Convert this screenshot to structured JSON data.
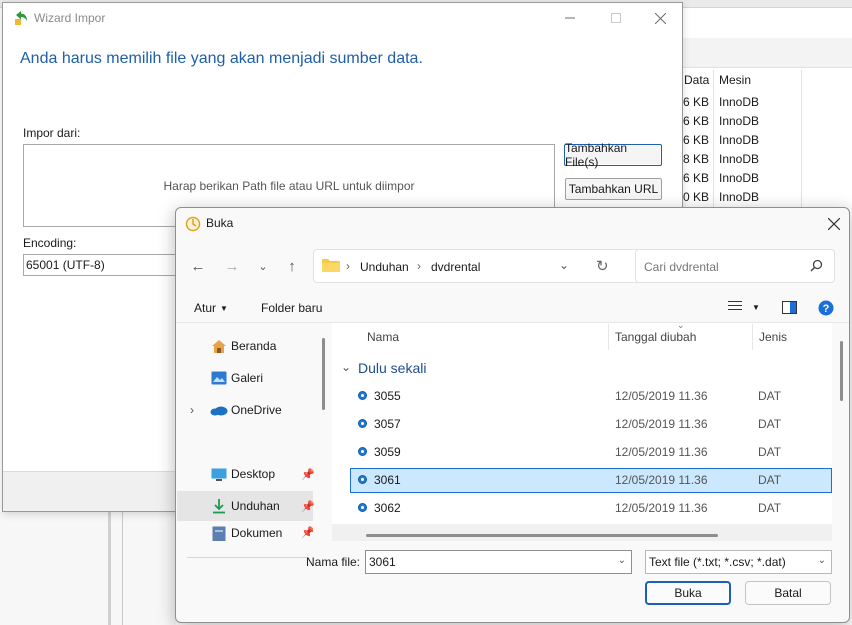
{
  "background": {
    "columns": [
      "Data",
      "Mesin"
    ],
    "rows": [
      {
        "data": "6 KB",
        "engine": "InnoDB"
      },
      {
        "data": "6 KB",
        "engine": "InnoDB"
      },
      {
        "data": "6 KB",
        "engine": "InnoDB"
      },
      {
        "data": "8 KB",
        "engine": "InnoDB"
      },
      {
        "data": "6 KB",
        "engine": "InnoDB"
      },
      {
        "data": "0 KB",
        "engine": "InnoDB"
      }
    ]
  },
  "wizard": {
    "title": "Wizard Impor",
    "heading": "Anda harus memilih file yang akan menjadi sumber data.",
    "import_label": "Impor dari:",
    "path_placeholder": "Harap berikan Path file atau URL untuk diimpor",
    "add_file_button": "Tambahkan File(s)",
    "add_url_button": "Tambahkan URL",
    "encoding_label": "Encoding:",
    "encoding_value": "65001 (UTF-8)"
  },
  "dialog": {
    "title": "Buka",
    "breadcrumb": [
      "Unduhan",
      "dvdrental"
    ],
    "search_placeholder": "Cari dvdrental",
    "toolbar": {
      "organize": "Atur",
      "new_folder": "Folder baru"
    },
    "nav": [
      {
        "label": "Beranda",
        "icon": "home-icon"
      },
      {
        "label": "Galeri",
        "icon": "gallery-icon"
      },
      {
        "label": "OneDrive",
        "icon": "cloud-icon"
      },
      {
        "label": "Desktop",
        "icon": "desktop-icon",
        "pinned": true
      },
      {
        "label": "Unduhan",
        "icon": "download-icon",
        "pinned": true,
        "selected": true
      },
      {
        "label": "Dokumen",
        "icon": "document-icon",
        "pinned": true
      }
    ],
    "columns": {
      "name": "Nama",
      "date": "Tanggal diubah",
      "type": "Jenis"
    },
    "group": "Dulu sekali",
    "files": [
      {
        "name": "3055",
        "date": "12/05/2019 11.36",
        "type": "DAT"
      },
      {
        "name": "3057",
        "date": "12/05/2019 11.36",
        "type": "DAT"
      },
      {
        "name": "3059",
        "date": "12/05/2019 11.36",
        "type": "DAT"
      },
      {
        "name": "3061",
        "date": "12/05/2019 11.36",
        "type": "DAT"
      },
      {
        "name": "3062",
        "date": "12/05/2019 11.36",
        "type": "DAT"
      }
    ],
    "selected_file": "3061",
    "filename_label": "Nama file:",
    "filename_value": "3061",
    "filetype_value": "Text file (*.txt; *.csv; *.dat)",
    "open_button": "Buka",
    "cancel_button": "Batal"
  },
  "colors": {
    "accent": "#1c5fb5",
    "heading": "#1f5fa9",
    "selection": "#cce8ff"
  }
}
